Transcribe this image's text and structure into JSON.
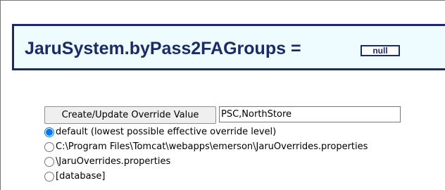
{
  "header": {
    "property_name": "JaruSystem.byPass2FAGroups =",
    "current_value": "null"
  },
  "form": {
    "submit_label": "Create/Update Override Value",
    "value_input": "PSC,NorthStore",
    "levels": [
      {
        "label": "default (lowest possible effective override level)",
        "selected": true
      },
      {
        "label": "C:\\Program Files\\Tomcat\\webapps\\emerson\\JaruOverrides.properties",
        "selected": false
      },
      {
        "label": "\\JaruOverrides.properties",
        "selected": false
      },
      {
        "label": "[database]",
        "selected": false
      }
    ]
  },
  "colors": {
    "title": "#1c2a6b",
    "title_background": "#eefcff",
    "radio_selected": "#0075ff"
  }
}
